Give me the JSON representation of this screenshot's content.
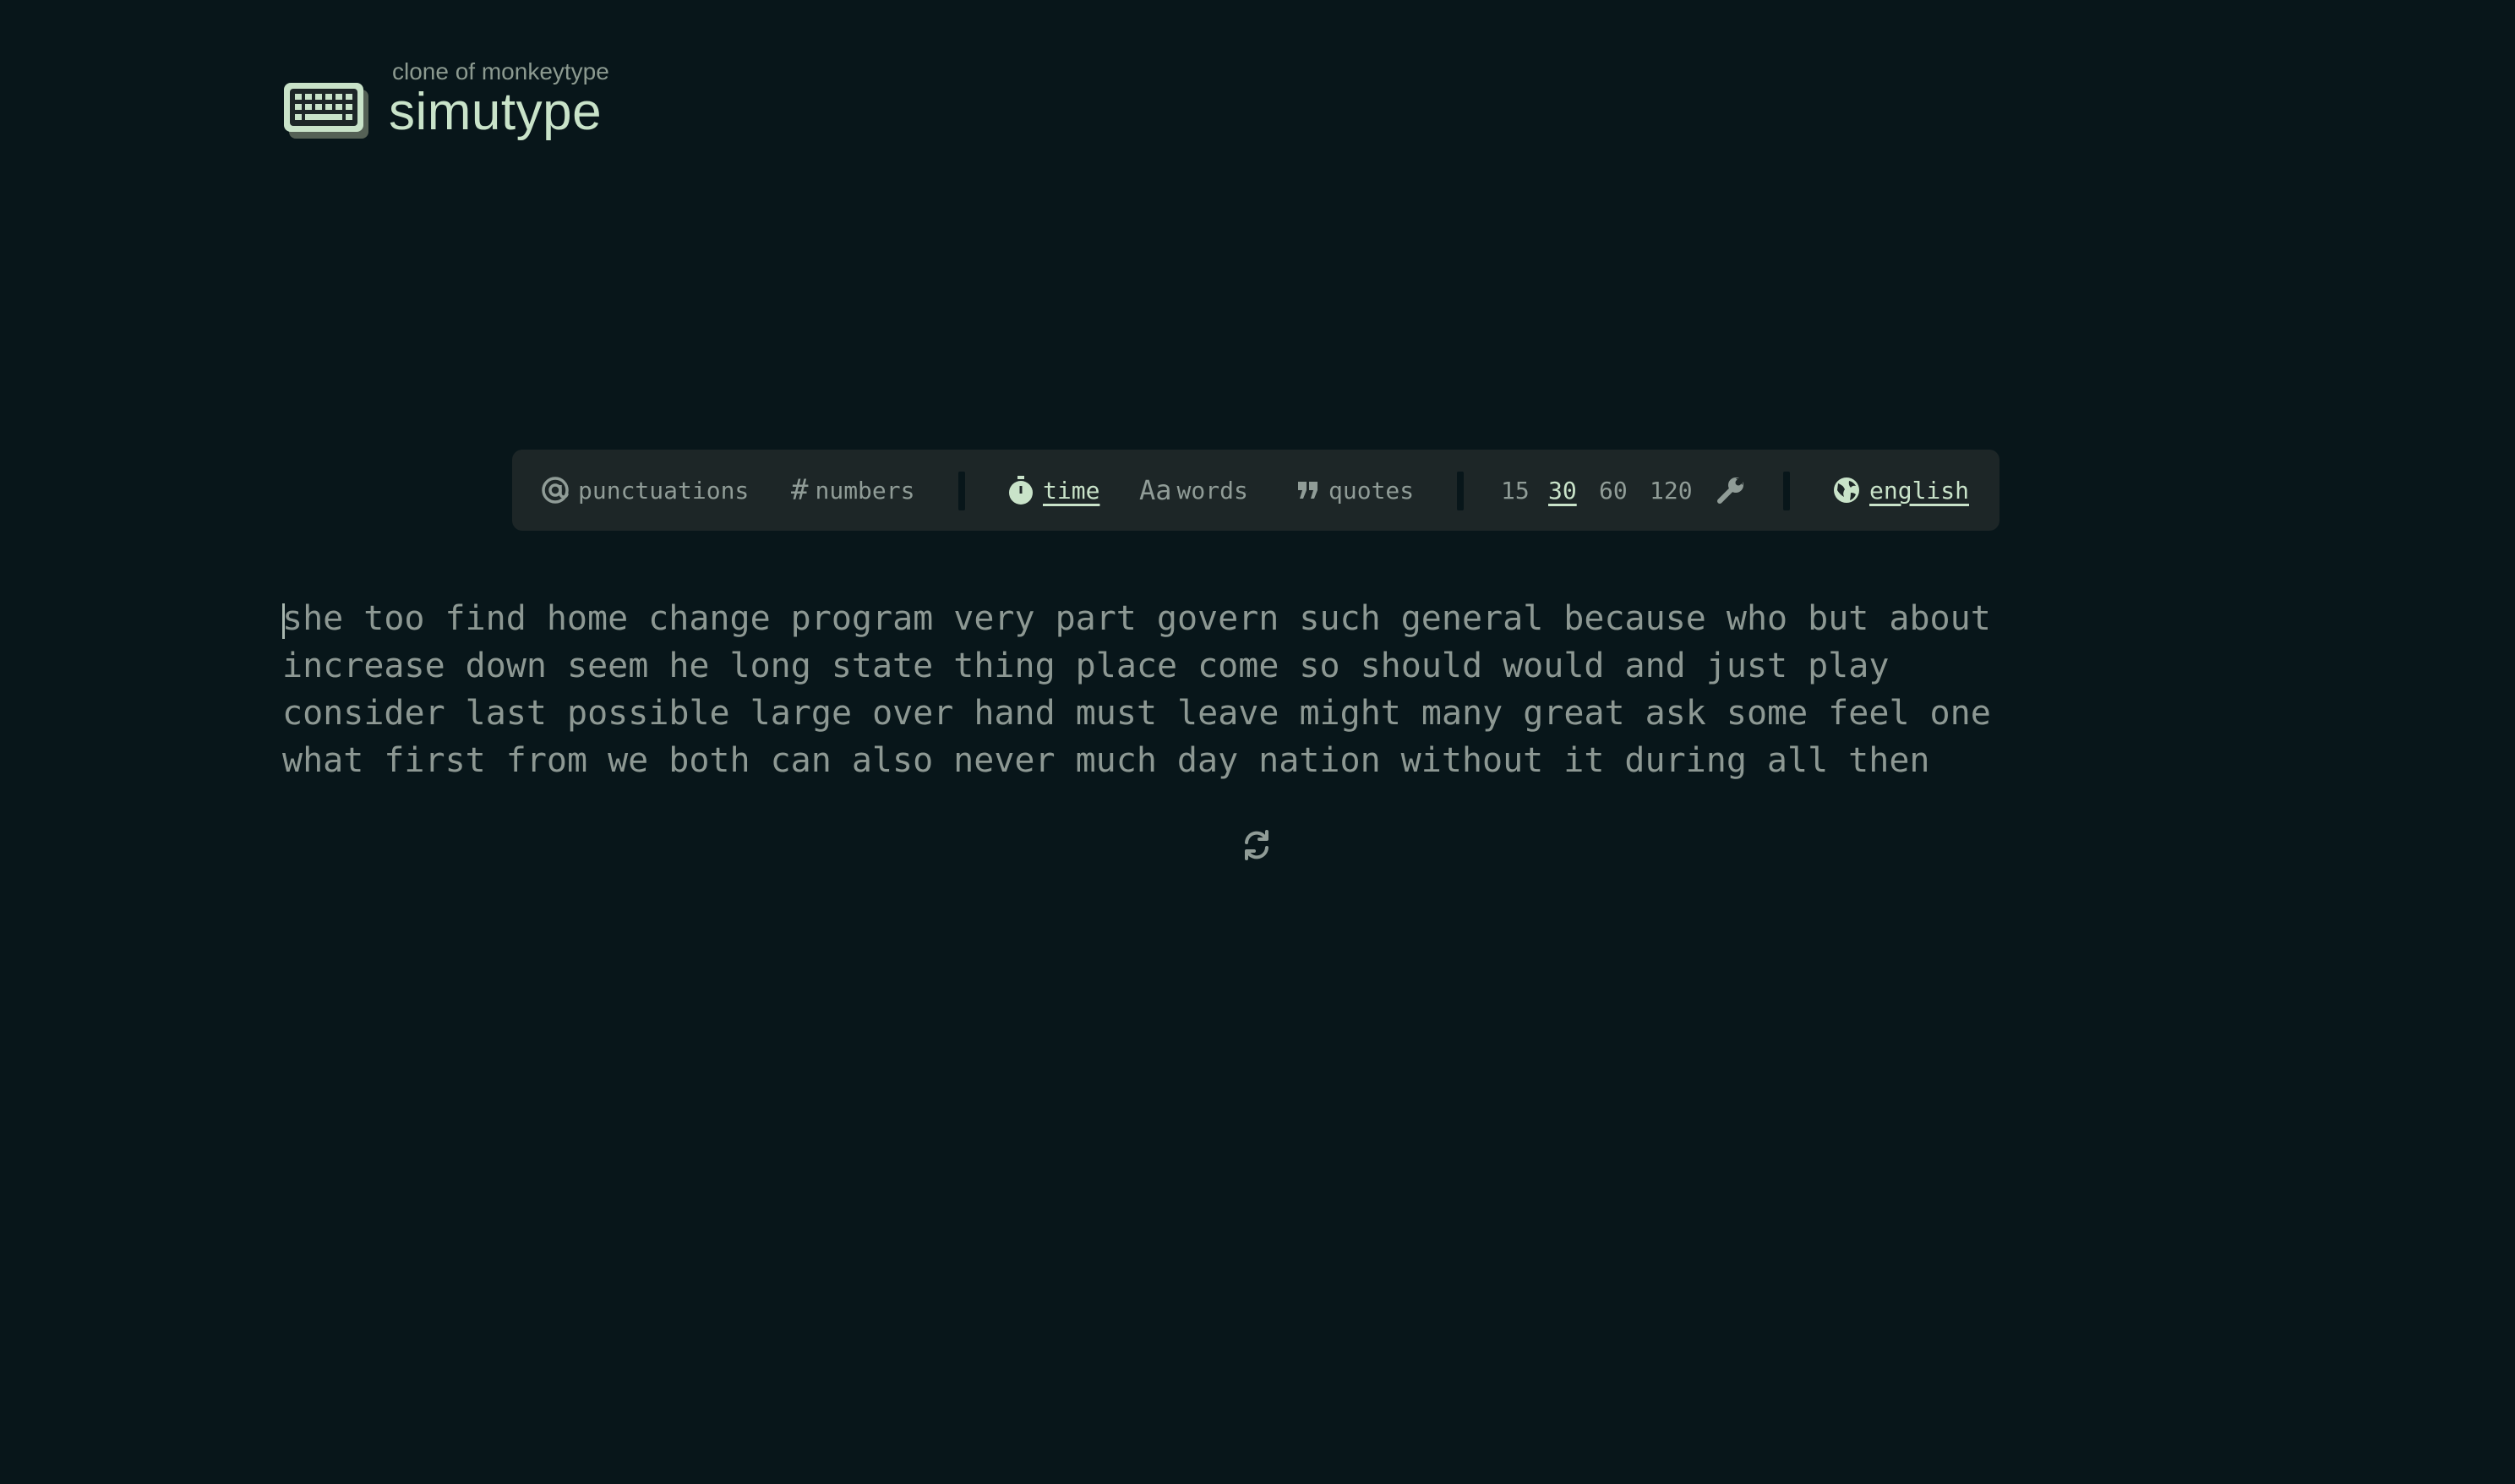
{
  "header": {
    "subtitle": "clone of monkeytype",
    "title": "simutype",
    "logo_icon": "keyboard-icon"
  },
  "toolbar": {
    "punctuation": {
      "label": "punctuations",
      "icon": "at-icon",
      "active": false
    },
    "numbers": {
      "label": "numbers",
      "icon": "hash-icon",
      "active": false
    },
    "modes": [
      {
        "label": "time",
        "icon": "stopwatch-icon",
        "active": true
      },
      {
        "label": "words",
        "icon": "font-size-icon",
        "active": false
      },
      {
        "label": "quotes",
        "icon": "quote-icon",
        "active": false
      }
    ],
    "durations": [
      {
        "label": "15",
        "active": false
      },
      {
        "label": "30",
        "active": true
      },
      {
        "label": "60",
        "active": false
      },
      {
        "label": "120",
        "active": false
      }
    ],
    "custom_icon": "wrench-icon",
    "language": {
      "label": "english",
      "icon": "globe-icon",
      "active": true
    }
  },
  "test": {
    "lines": [
      [
        "she",
        "too",
        "find",
        "home",
        "change",
        "program",
        "very",
        "part",
        "govern",
        "such",
        "general",
        "because",
        "who",
        "but",
        "about"
      ],
      [
        "increase",
        "down",
        "seem",
        "he",
        "long",
        "state",
        "thing",
        "place",
        "come",
        "so",
        "should",
        "would",
        "and",
        "just",
        "play"
      ],
      [
        "consider",
        "last",
        "possible",
        "large",
        "over",
        "hand",
        "must",
        "leave",
        "might",
        "many",
        "great",
        "ask",
        "some",
        "feel",
        "one"
      ],
      [
        "what",
        "first",
        "from",
        "we",
        "both",
        "can",
        "also",
        "never",
        "much",
        "day",
        "nation",
        "without",
        "it",
        "during",
        "all",
        "then"
      ]
    ],
    "restart_icon": "refresh-icon"
  },
  "colors": {
    "background": "#08161a",
    "toolbar_bg": "#1d2627",
    "accent": "#c9e3c9",
    "text_muted": "#8d9893"
  }
}
